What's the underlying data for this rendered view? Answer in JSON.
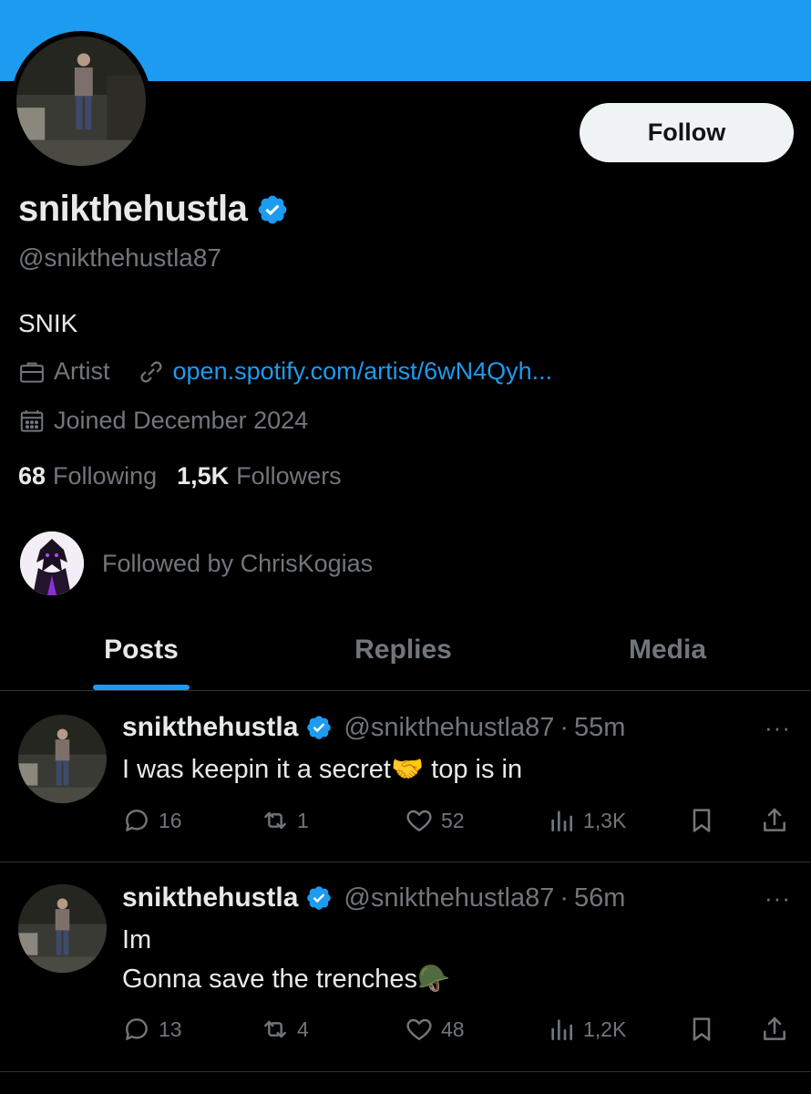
{
  "colors": {
    "accent": "#1d9bf0",
    "background": "#000000",
    "text_primary": "#e7e9ea",
    "text_secondary": "#71767b",
    "divider": "#2f3336",
    "button_bg": "#eff3f4"
  },
  "profile": {
    "follow_label": "Follow",
    "display_name": "snikthehustla",
    "handle": "@snikthehustla87",
    "bio": "SNIK",
    "category_icon": "briefcase-icon",
    "category": "Artist",
    "link_icon": "link-icon",
    "link": "open.spotify.com/artist/6wN4Qyh...",
    "joined_icon": "calendar-icon",
    "joined": "Joined December 2024",
    "following_count": "68",
    "following_label": "Following",
    "followers_count": "1,5K",
    "followers_label": "Followers",
    "followed_by": "Followed by ChrisKogias"
  },
  "tabs": [
    {
      "label": "Posts",
      "active": true
    },
    {
      "label": "Replies",
      "active": false
    },
    {
      "label": "Media",
      "active": false
    }
  ],
  "posts": [
    {
      "name": "snikthehustla",
      "handle": "@snikthehustla87",
      "dot": "·",
      "time": "55m",
      "more": "···",
      "text": "I was keepin it a secret🤝 top is in",
      "replies": "16",
      "reposts": "1",
      "likes": "52",
      "views": "1,3K"
    },
    {
      "name": "snikthehustla",
      "handle": "@snikthehustla87",
      "dot": "·",
      "time": "56m",
      "more": "···",
      "text": "Im\nGonna save the trenches🪖",
      "replies": "13",
      "reposts": "4",
      "likes": "48",
      "views": "1,2K"
    }
  ]
}
